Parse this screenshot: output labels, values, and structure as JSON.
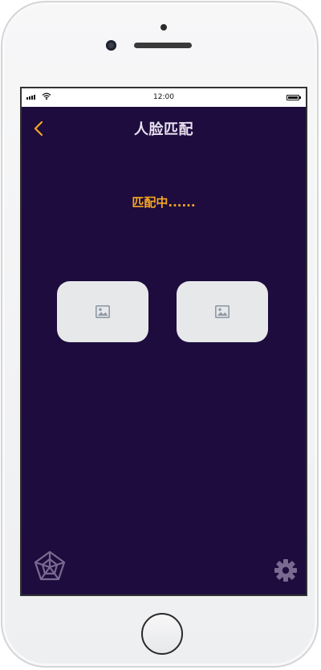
{
  "statusbar": {
    "time": "12:00"
  },
  "header": {
    "title": "人脸匹配",
    "back_icon": "chevron-left-icon"
  },
  "main": {
    "status_text": "匹配中......",
    "images": [
      {
        "icon": "image-placeholder-icon"
      },
      {
        "icon": "image-placeholder-icon"
      }
    ]
  },
  "footer": {
    "left_icon": "pentagon-radar-icon",
    "right_icon": "gear-icon"
  },
  "colors": {
    "screen_bg": "#1d0c3d",
    "accent": "#f5a623",
    "title": "#e6e0ee",
    "card": "#e7e8ea"
  }
}
